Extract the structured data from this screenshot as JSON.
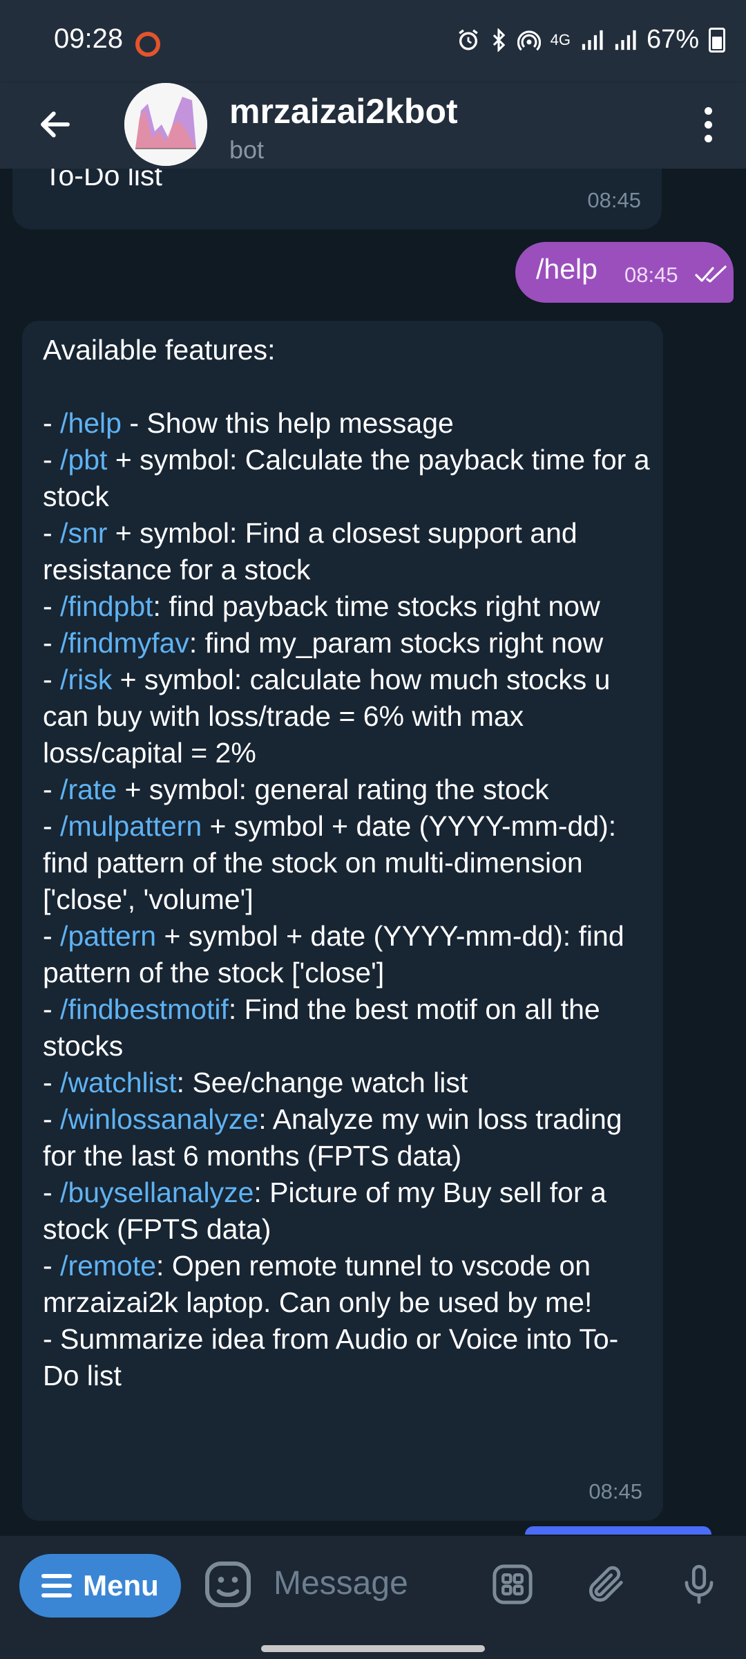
{
  "status_bar": {
    "time": "09:28",
    "network": "4G",
    "battery": "67%",
    "icons": [
      "record-icon",
      "alarm-icon",
      "bluetooth-icon",
      "hotspot-icon",
      "signal-icon",
      "battery-icon"
    ]
  },
  "header": {
    "title": "mrzaizai2kbot",
    "subtitle": "bot",
    "icons": [
      "back-arrow-icon",
      "avatar-chart",
      "more-vert-icon"
    ]
  },
  "messages": [
    {
      "direction": "in",
      "text": "To-Do list",
      "time": "08:45"
    },
    {
      "direction": "out",
      "text": "/help",
      "time": "08:45",
      "status": "read"
    },
    {
      "direction": "in",
      "time": "08:45",
      "intro": "Available features:",
      "lines": [
        {
          "prefix": "- ",
          "cmd": "/help",
          "rest": " - Show this help message"
        },
        {
          "prefix": "- ",
          "cmd": "/pbt",
          "rest": " + symbol: Calculate the payback time for a stock"
        },
        {
          "prefix": "- ",
          "cmd": "/snr",
          "rest": " + symbol: Find a closest support and resistance for a stock"
        },
        {
          "prefix": "- ",
          "cmd": "/findpbt",
          "rest": ": find payback time stocks right now"
        },
        {
          "prefix": "- ",
          "cmd": "/findmyfav",
          "rest": ": find my_param stocks right now"
        },
        {
          "prefix": "- ",
          "cmd": "/risk",
          "rest": " + symbol: calculate how much stocks u can buy with loss/trade = 6% with max loss/capital = 2%"
        },
        {
          "prefix": "- ",
          "cmd": "/rate",
          "rest": " + symbol: general rating the stock"
        },
        {
          "prefix": "- ",
          "cmd": "/mulpattern",
          "rest": " + symbol + date (YYYY-mm-dd): find pattern of the stock on multi-dimension ['close', 'volume']"
        },
        {
          "prefix": "- ",
          "cmd": "/pattern",
          "rest": " + symbol + date (YYYY-mm-dd): find pattern of the stock ['close']"
        },
        {
          "prefix": "- ",
          "cmd": "/findbestmotif",
          "rest": ": Find the best motif on all the stocks"
        },
        {
          "prefix": "- ",
          "cmd": "/watchlist",
          "rest": ": See/change watch list"
        },
        {
          "prefix": "- ",
          "cmd": "/winlossanalyze",
          "rest": ": Analyze my win loss trading for the last 6 months (FPTS data)"
        },
        {
          "prefix": "- ",
          "cmd": "/buysellanalyze",
          "rest": ": Picture of my Buy sell for a stock (FPTS data)"
        },
        {
          "prefix": "- ",
          "cmd": "/remote",
          "rest": ": Open remote tunnel to vscode on mrzaizai2k laptop. Can only be used by me!"
        },
        {
          "prefix": "- ",
          "cmd": "",
          "rest": "Summarize idea from Audio or Voice into To-Do list"
        }
      ]
    }
  ],
  "input_bar": {
    "menu_label": "Menu",
    "placeholder": "Message",
    "icons": [
      "emoji-icon",
      "commands-icon",
      "attach-icon",
      "mic-icon"
    ]
  },
  "colors": {
    "header_bg": "#232e3c",
    "chat_bg": "#0f1a22",
    "incoming_bubble": "#182533",
    "outgoing_bubble": "#9b4fbd",
    "link": "#5fb3f3",
    "menu_button": "#3a86d5"
  }
}
